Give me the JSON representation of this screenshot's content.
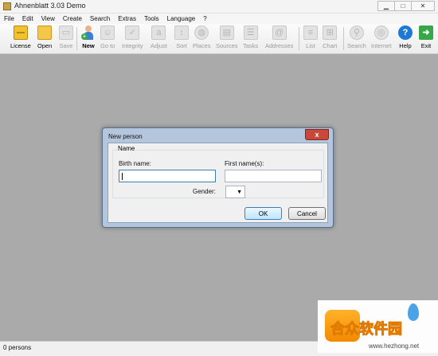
{
  "window": {
    "title": "Ahnenblatt 3.03 Demo",
    "minimize_glyph": "▁",
    "maximize_glyph": "□",
    "close_glyph": "✕"
  },
  "menu": [
    "File",
    "Edit",
    "View",
    "Create",
    "Search",
    "Extras",
    "Tools",
    "Language",
    "?"
  ],
  "toolbar": {
    "buttons": [
      {
        "label": "License",
        "icon": "license-icon",
        "enabled": true
      },
      {
        "label": "Open",
        "icon": "folder-icon",
        "enabled": true
      },
      {
        "label": "Save",
        "icon": "save-icon",
        "enabled": false
      },
      {
        "label": "New",
        "icon": "new-person-icon",
        "enabled": true
      },
      {
        "label": "Go to",
        "icon": "goto-person-icon",
        "enabled": false
      },
      {
        "label": "Integrity",
        "icon": "integrity-icon",
        "enabled": false
      },
      {
        "label": "Adjust",
        "icon": "adjust-icon",
        "enabled": false
      },
      {
        "label": "Sort",
        "icon": "sort-icon",
        "enabled": false
      },
      {
        "label": "Places",
        "icon": "globe-icon",
        "enabled": false
      },
      {
        "label": "Sources",
        "icon": "sources-icon",
        "enabled": false
      },
      {
        "label": "Tasks",
        "icon": "tasks-icon",
        "enabled": false
      },
      {
        "label": "Addresses",
        "icon": "addresses-icon",
        "enabled": false
      },
      {
        "label": "List",
        "icon": "list-icon",
        "enabled": false
      },
      {
        "label": "Chart",
        "icon": "chart-icon",
        "enabled": false
      },
      {
        "label": "Search",
        "icon": "search-icon",
        "enabled": false
      },
      {
        "label": "Internet",
        "icon": "internet-icon",
        "enabled": false
      },
      {
        "label": "Help",
        "icon": "help-icon",
        "enabled": true
      },
      {
        "label": "Exit",
        "icon": "exit-icon",
        "enabled": true
      }
    ]
  },
  "status": {
    "text": "0 persons"
  },
  "dialog": {
    "title": "New person",
    "close_glyph": "x",
    "group_label": "Name",
    "birth_name_label": "Birth name:",
    "birth_name_value": "",
    "first_names_label": "First name(s):",
    "first_names_value": "",
    "gender_label": "Gender:",
    "gender_value": "",
    "dropdown_glyph": "▼",
    "ok_label": "OK",
    "cancel_label": "Cancel"
  },
  "watermark": {
    "text": "合众软件园",
    "url": "www.hezhong.net"
  },
  "colors": {
    "workspace": "#aaaaaa",
    "dialog_frame": "#b4c6dc",
    "close_button": "#c9483a",
    "help_blue": "#1e78d6",
    "exit_green": "#3aa64a",
    "watermark_orange": "#f28a00"
  }
}
